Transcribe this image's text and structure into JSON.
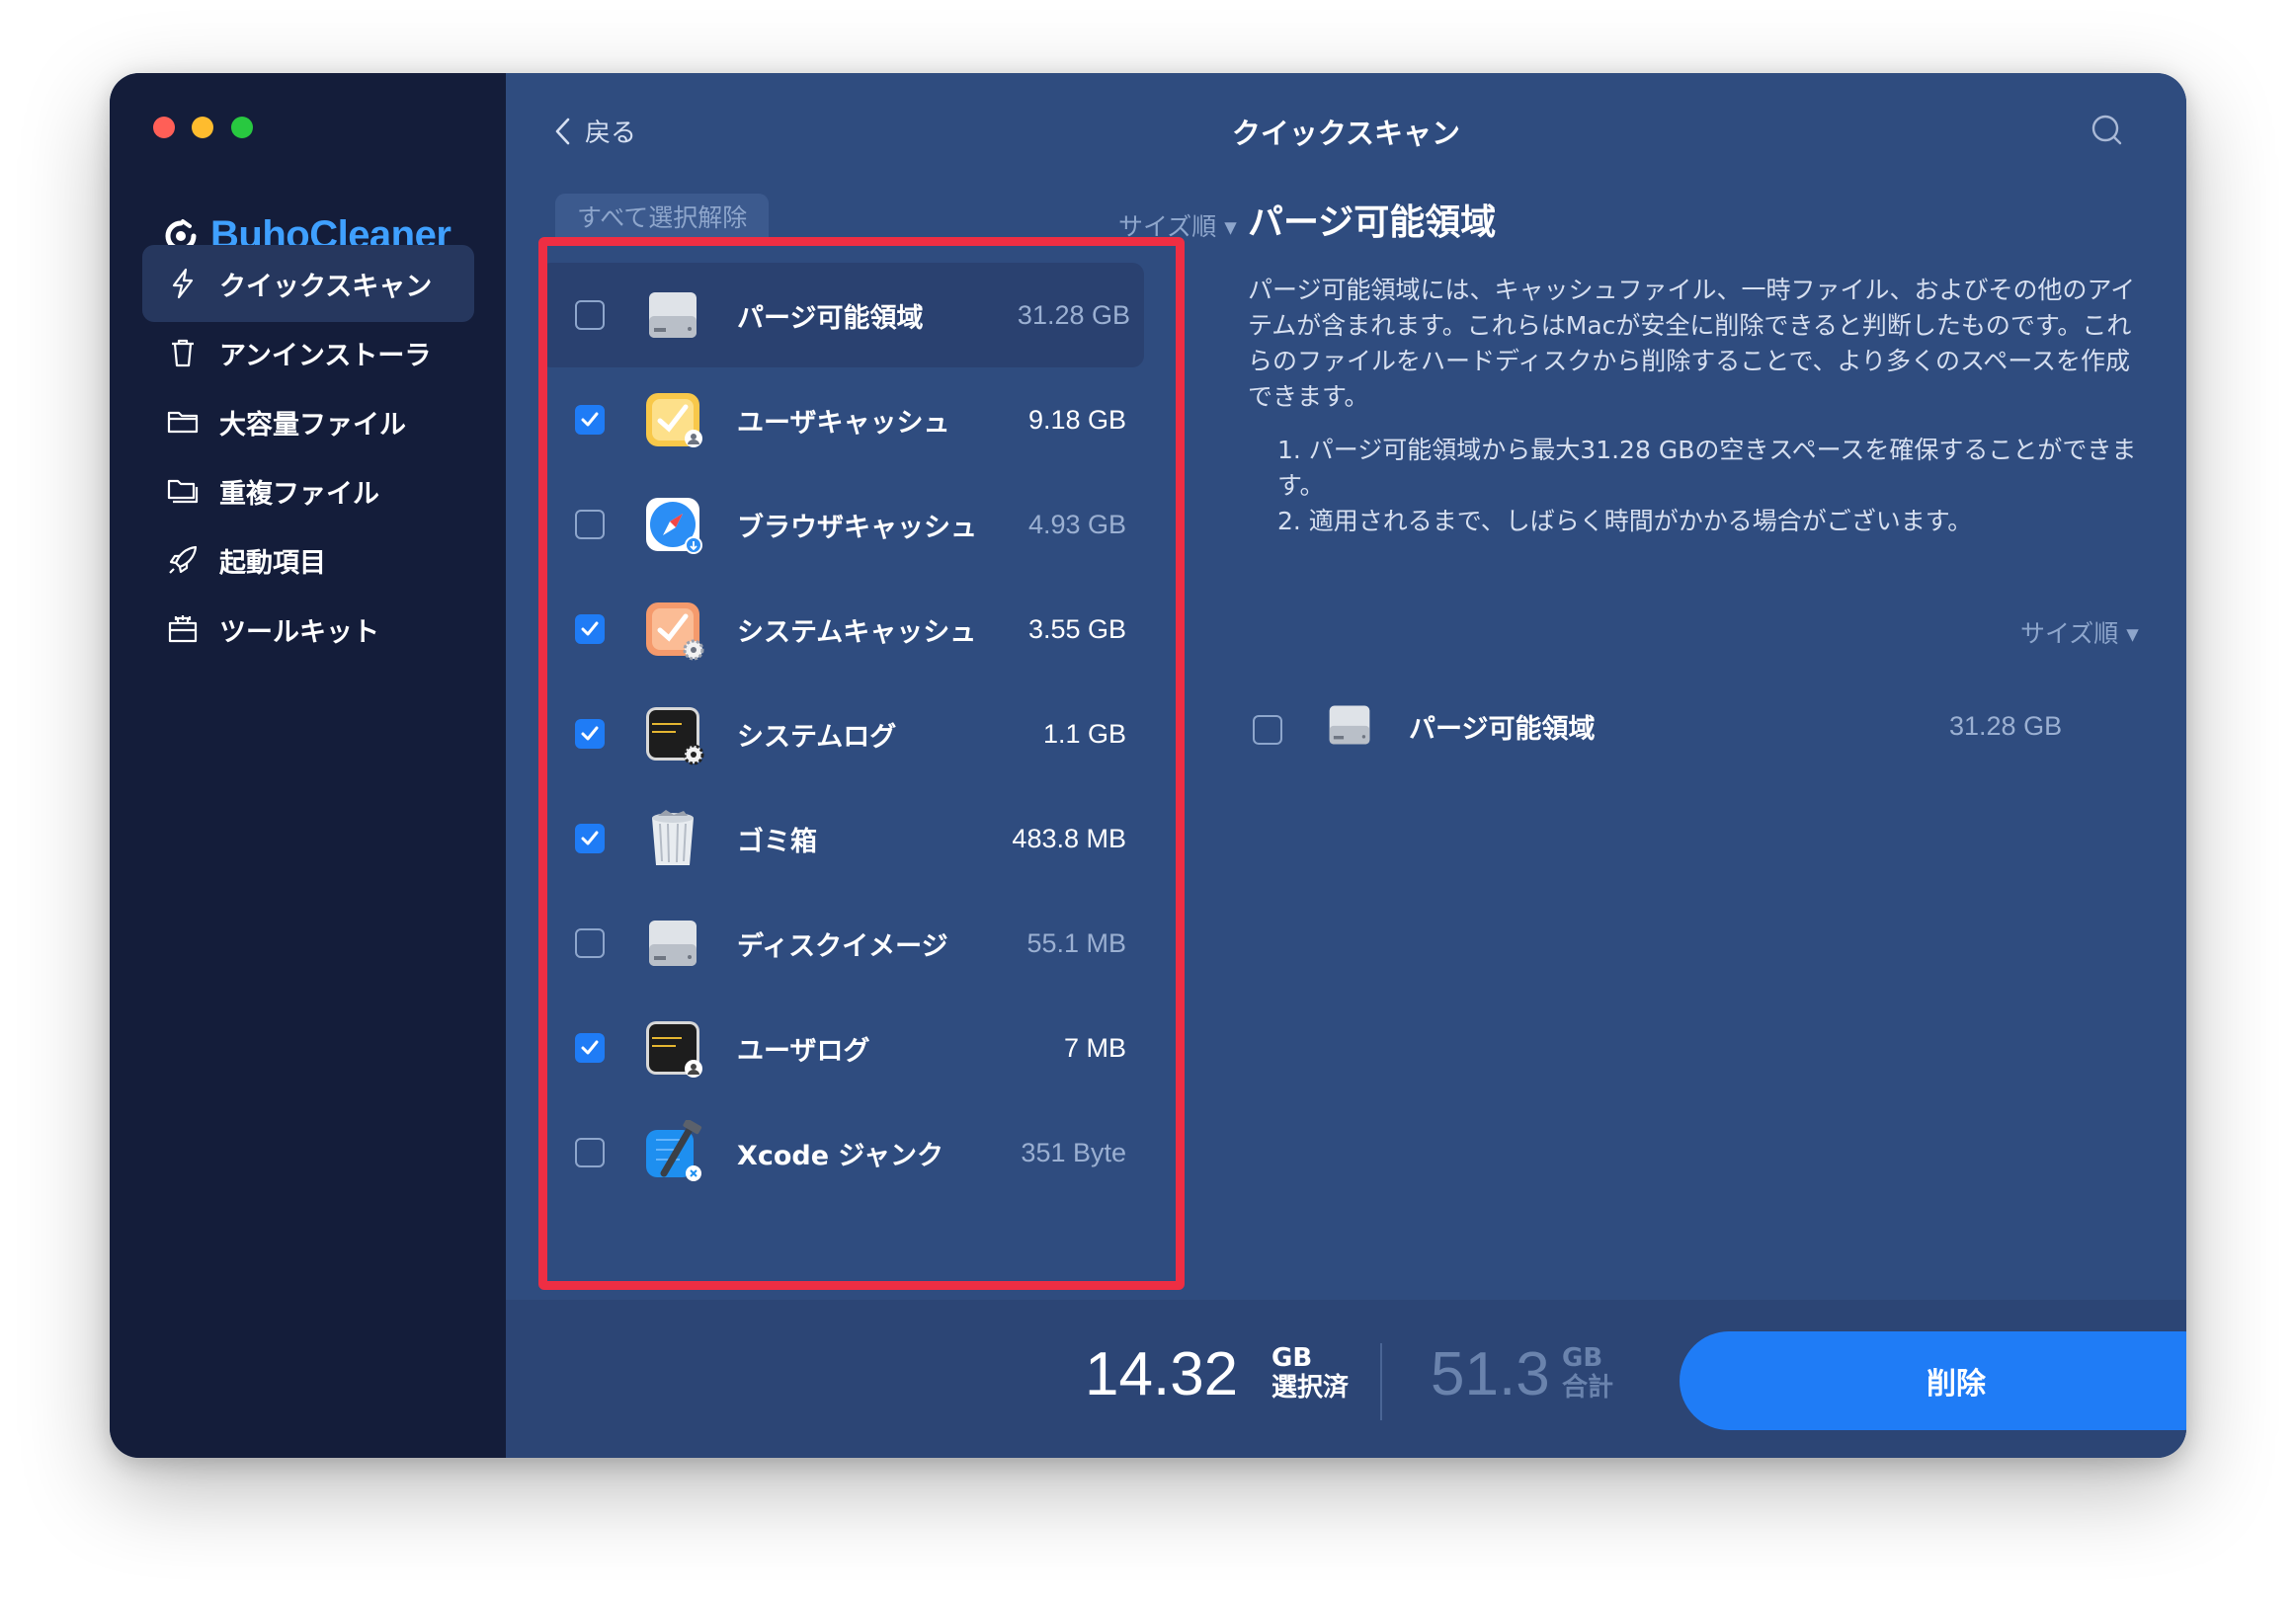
{
  "app": {
    "name": "BuhoCleaner",
    "brand_color": "#3fa0ff"
  },
  "sidebar": {
    "items": [
      {
        "label": "クイックスキャン",
        "icon": "lightning-icon",
        "active": true
      },
      {
        "label": "アンインストーラ",
        "icon": "trash-icon",
        "active": false
      },
      {
        "label": "大容量ファイル",
        "icon": "folder-icon",
        "active": false
      },
      {
        "label": "重複ファイル",
        "icon": "duplicate-folder-icon",
        "active": false
      },
      {
        "label": "起動項目",
        "icon": "rocket-icon",
        "active": false
      },
      {
        "label": "ツールキット",
        "icon": "toolbox-icon",
        "active": false
      }
    ]
  },
  "header": {
    "back_label": "戻る",
    "title": "クイックスキャン"
  },
  "list": {
    "deselect_all_label": "すべて選択解除",
    "sort_label": "サイズ順 ▾",
    "items": [
      {
        "name": "パージ可能領域",
        "size": "31.28 GB",
        "checked": false,
        "icon": "disk-drive-icon"
      },
      {
        "name": "ユーザキャッシュ",
        "size": "9.18 GB",
        "checked": true,
        "icon": "user-cache-icon"
      },
      {
        "name": "ブラウザキャッシュ",
        "size": "4.93 GB",
        "checked": false,
        "icon": "safari-icon"
      },
      {
        "name": "システムキャッシュ",
        "size": "3.55 GB",
        "checked": true,
        "icon": "system-cache-icon"
      },
      {
        "name": "システムログ",
        "size": "1.1 GB",
        "checked": true,
        "icon": "system-log-icon"
      },
      {
        "name": "ゴミ箱",
        "size": "483.8 MB",
        "checked": true,
        "icon": "trash-bin-icon"
      },
      {
        "name": "ディスクイメージ",
        "size": "55.1 MB",
        "checked": false,
        "icon": "disk-image-icon"
      },
      {
        "name": "ユーザログ",
        "size": "7 MB",
        "checked": true,
        "icon": "user-log-icon"
      },
      {
        "name": "Xcode ジャンク",
        "size": "351 Byte",
        "checked": false,
        "icon": "xcode-icon"
      }
    ]
  },
  "detail": {
    "title": "パージ可能領域",
    "description": "パージ可能領域には、キャッシュファイル、一時ファイル、およびその他のアイテムが含まれます。これらはMacが安全に削除できると判断したものです。これらのファイルをハードディスクから削除することで、より多くのスペースを作成できます。",
    "note_1": "1. パージ可能領域から最大31.28 GBの空きスペースを確保することができます。",
    "note_2": "2. 適用されるまで、しばらく時間がかかる場合がございます。",
    "sort_label": "サイズ順 ▾",
    "item_name": "パージ可能領域",
    "item_size": "31.28 GB"
  },
  "footer": {
    "selected_value": "14.32",
    "selected_unit": "GB",
    "selected_label": "選択済",
    "total_value": "51.3",
    "total_unit": "GB",
    "total_label": "合計",
    "delete_label": "削除"
  },
  "colors": {
    "sidebar_bg": "#141d3a",
    "main_bg": "#2f4c7f",
    "accent": "#1f7cf6",
    "highlight": "#ee2e43"
  }
}
